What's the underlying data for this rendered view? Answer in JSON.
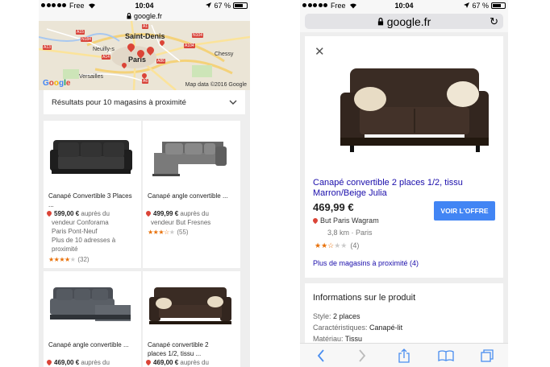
{
  "status": {
    "carrier": "Free",
    "time": "10:04",
    "battery": "67 %"
  },
  "left": {
    "url": "google.fr",
    "map": {
      "places": [
        "Saint-Denis",
        "Neuilly-s",
        "Paris",
        "Versailles",
        "Chessy"
      ],
      "roads": [
        "A13",
        "A15",
        "A1",
        "A86",
        "A104",
        "A6",
        "N184",
        "N104",
        "A14"
      ],
      "credit": "Map data ©2016 Google",
      "logo": "Google"
    },
    "dropdown_label": "Résultats pour 10 magasins à proximité",
    "products": [
      {
        "title": "Canapé Convertible 3 Places ...",
        "price": "599,00 €",
        "price_suffix": " auprès du",
        "store_line1": "vendeur Conforama",
        "store_line2": "Paris Pont-Neuf",
        "more_line1": "Plus de 10 adresses à",
        "more_line2": "proximité",
        "rating": 4,
        "count": "(32)"
      },
      {
        "title": "Canapé angle convertible ...",
        "price": "499,99 €",
        "price_suffix": " auprès du",
        "store_line1": "vendeur But Fresnes",
        "rating": 3.5,
        "count": "(55)"
      },
      {
        "title": "Canapé angle convertible ...",
        "price": "469,00 €",
        "price_suffix": " auprès du"
      },
      {
        "title_line1": "Canapé convertible 2",
        "title_line2": "places 1/2, tissu ...",
        "price": "469,00 €",
        "price_suffix": " auprès du"
      }
    ]
  },
  "right": {
    "url": "google.fr",
    "product_title": "Canapé convertible 2 places 1/2, tissu Marron/Beige Julia",
    "price": "469,99 €",
    "store": "But Paris Wagram",
    "distance": "3,8 km · Paris",
    "rating": 2.5,
    "rating_count": "(4)",
    "offer_button": "VOIR L'OFFRE",
    "more_stores": "Plus de magasins à proximité (4)",
    "info_title": "Informations sur le produit",
    "info": [
      {
        "key": "Style:",
        "value": "2 places"
      },
      {
        "key": "Caractéristiques:",
        "value": "Canapé-lit"
      },
      {
        "key": "Matériau:",
        "value": "Tissu"
      }
    ]
  },
  "colors": {
    "link": "#1a0dab",
    "button": "#4285f4",
    "pin": "#db4437",
    "stars": "#e8710a"
  },
  "icons": [
    "signal-dots-icon",
    "wifi-icon",
    "lock-icon",
    "battery-icon",
    "chevron-down-icon",
    "close-icon",
    "reload-icon",
    "back-icon",
    "forward-icon",
    "share-icon",
    "bookmarks-icon",
    "tabs-icon",
    "map-pin-icon",
    "star-icon"
  ]
}
